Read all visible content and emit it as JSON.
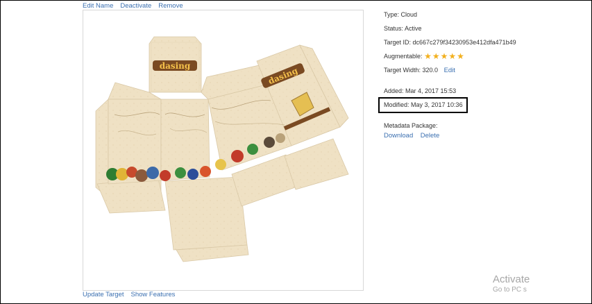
{
  "actions_top": {
    "edit_name": "Edit Name",
    "deactivate": "Deactivate",
    "remove": "Remove"
  },
  "actions_bottom": {
    "update_target": "Update Target",
    "show_features": "Show Features"
  },
  "image": {
    "box_title_1": "dasing",
    "box_title_2": "dasing"
  },
  "details": {
    "type": "Type: Cloud",
    "status": "Status: Active",
    "target_id": "Target ID: dc667c279f34230953e412dfa471b49",
    "augmentable_label": "Augmentable:",
    "augmentable_rating": 5,
    "augmentable_stars": "★★★★★",
    "target_width": "Target Width: 320.0",
    "edit": "Edit",
    "added": "Added: Mar 4, 2017 15:53",
    "modified": "Modified: May 3, 2017 10:36",
    "metadata_label": "Metadata Package:",
    "download": "Download",
    "delete": "Delete"
  },
  "watermark": {
    "line1": "Activate",
    "line2": "Go to PC s"
  },
  "colors": {
    "link": "#3a6fb0",
    "star": "#f2b01e",
    "package_paper": "#efe1c4",
    "package_brown": "#7a4a22"
  }
}
